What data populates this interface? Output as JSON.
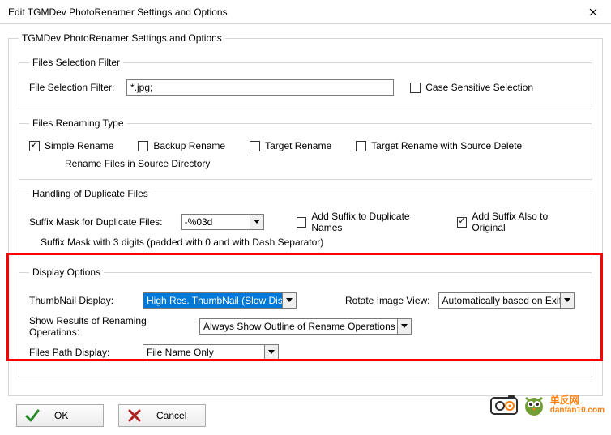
{
  "window": {
    "title": "Edit TGMDev PhotoRenamer Settings and Options"
  },
  "main_group": {
    "legend": "TGMDev PhotoRenamer Settings and Options"
  },
  "filter_group": {
    "legend": "Files Selection Filter",
    "label": "File Selection Filter:",
    "value": "*.jpg;",
    "case_sensitive_label": "Case Sensitive Selection",
    "case_sensitive_checked": false
  },
  "rename_group": {
    "legend": "Files Renaming Type",
    "simple": {
      "label": "Simple Rename",
      "checked": true
    },
    "backup": {
      "label": "Backup Rename",
      "checked": false
    },
    "target": {
      "label": "Target Rename",
      "checked": false
    },
    "target_delete": {
      "label": "Target Rename with Source Delete",
      "checked": false
    },
    "hint": "Rename Files in Source Directory"
  },
  "dup_group": {
    "legend": "Handling of Duplicate Files",
    "mask_label": "Suffix Mask for Duplicate Files:",
    "mask_value": "-%03d",
    "add_suffix_dup": {
      "label": "Add Suffix to Duplicate Names",
      "checked": false
    },
    "add_suffix_orig": {
      "label": "Add Suffix Also to Original",
      "checked": true
    },
    "hint": "Suffix Mask with 3 digits (padded with 0 and with Dash Separator)"
  },
  "display_group": {
    "legend": "Display Options",
    "thumb_label": "ThumbNail Display:",
    "thumb_value": "High Res. ThumbNail (Slow Display)",
    "rotate_label": "Rotate Image View:",
    "rotate_value": "Automatically based on Exif",
    "results_label": "Show Results of Renaming Operations:",
    "results_value": "Always Show Outline of Rename Operations",
    "path_label": "Files Path Display:",
    "path_value": "File Name Only"
  },
  "buttons": {
    "ok": "OK",
    "cancel": "Cancel"
  },
  "watermark": {
    "line1": "单反网",
    "line2": "danfan10.com"
  }
}
